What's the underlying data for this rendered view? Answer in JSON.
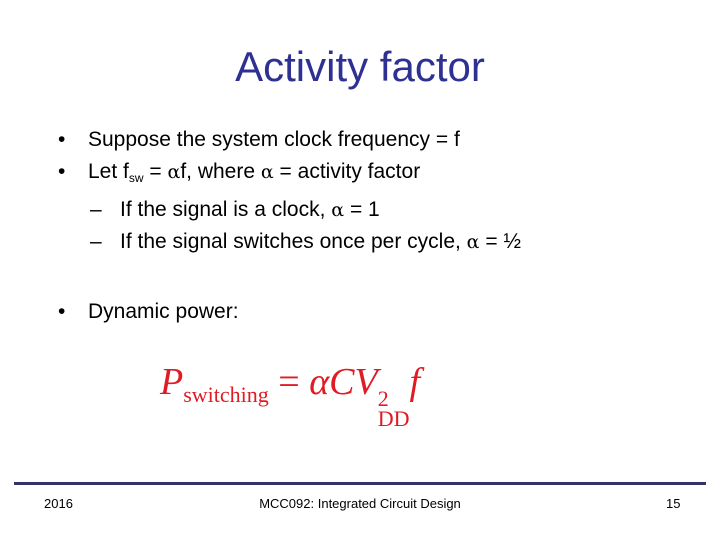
{
  "slide": {
    "title": "Activity factor",
    "bullets": [
      {
        "marker": "•",
        "text": "Suppose the system clock frequency = f"
      },
      {
        "marker": "•",
        "parts": {
          "a": "Let f",
          "sub": "sw",
          "b": " = ",
          "alpha1": "α",
          "c": "f, where ",
          "alpha2": "α",
          "d": " = activity factor"
        }
      },
      {
        "marker": "–",
        "parts": {
          "a": "If the signal is a clock, ",
          "alpha": "α",
          "b": " = 1"
        }
      },
      {
        "marker": "–",
        "parts": {
          "a": "If the signal switches once per cycle, ",
          "alpha": "α",
          "b": " = ½"
        }
      }
    ],
    "dynamic": {
      "marker": "•",
      "text": "Dynamic power:"
    },
    "equation": {
      "P": "P",
      "P_sub": "switching",
      "eq": " = ",
      "alpha": "α",
      "C": "C",
      "V": "V",
      "V_sup": "2",
      "V_sub": "DD",
      "f": "f"
    },
    "colors": {
      "title": "#2e3192",
      "equation": "#e01b24",
      "rule": "#33336b"
    }
  },
  "footer": {
    "year": "2016",
    "course": "MCC092: Integrated Circuit Design",
    "page": "15"
  }
}
